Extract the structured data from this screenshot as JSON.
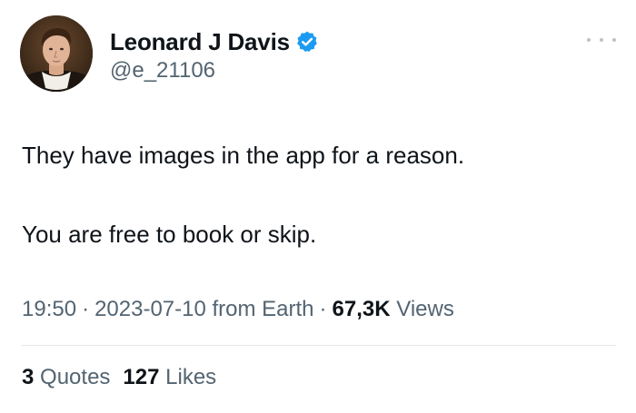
{
  "author": {
    "display_name": "Leonard J Davis",
    "handle": "@e_21106",
    "verified": true,
    "avatar_icon": "portrait-avatar"
  },
  "tweet": {
    "line1": "They have images in the app for a reason.",
    "line2": "You are free to book or skip."
  },
  "meta": {
    "time": "19:50",
    "separator": "·",
    "date": "2023-07-10",
    "source": "from Earth",
    "views_count": "67,3K",
    "views_label": "Views"
  },
  "stats": {
    "quotes_count": "3",
    "quotes_label": "Quotes",
    "likes_count": "127",
    "likes_label": "Likes"
  },
  "colors": {
    "text_primary": "#0f1419",
    "text_secondary": "#536471",
    "verified_blue": "#1d9bf0",
    "divider": "#e3e8eb"
  }
}
